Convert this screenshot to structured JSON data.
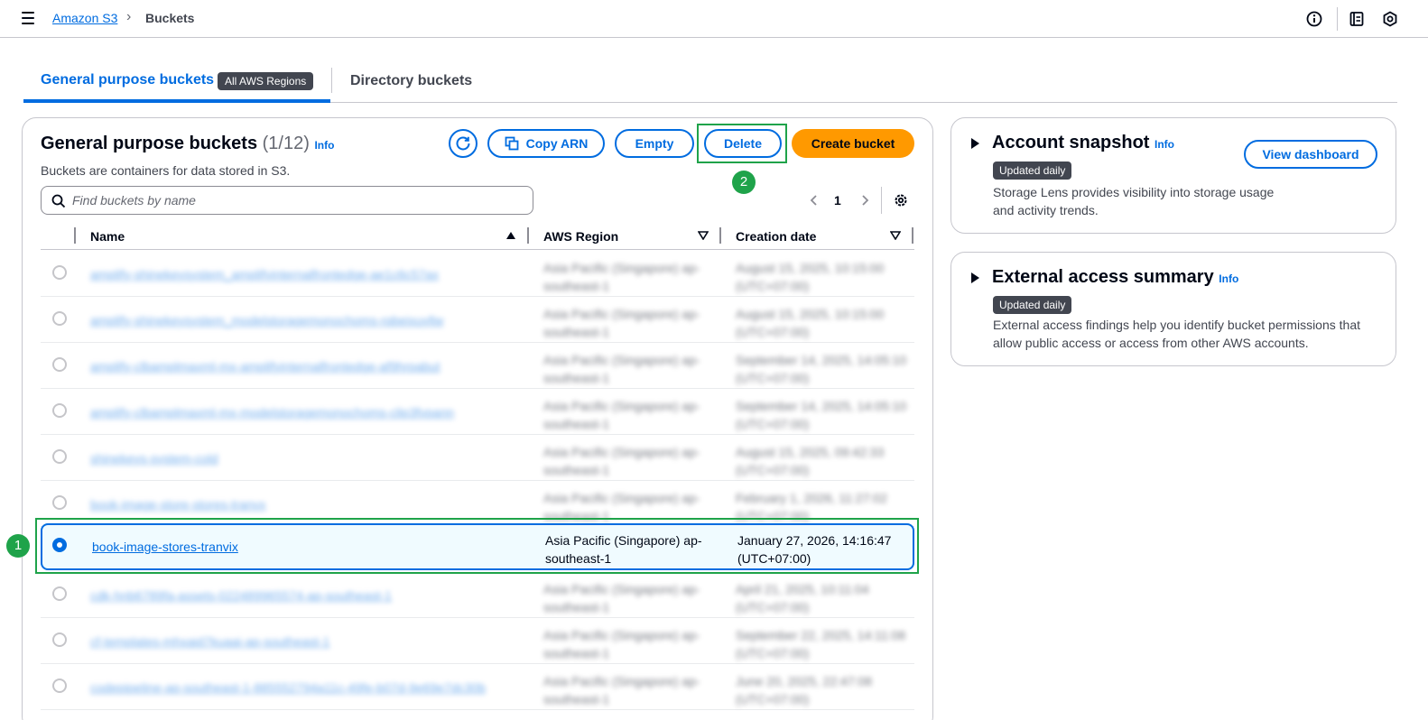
{
  "topbar": {
    "breadcrumb_root": "Amazon S3",
    "breadcrumb_separator": "›",
    "breadcrumb_current": "Buckets"
  },
  "tabs": {
    "general_label": "General purpose buckets",
    "general_badge": "All AWS Regions",
    "directory_label": "Directory buckets"
  },
  "panel": {
    "title": "General purpose buckets",
    "count": "(1/12)",
    "info": "Info",
    "description": "Buckets are containers for data stored in S3.",
    "buttons": {
      "copy_arn": "Copy ARN",
      "empty": "Empty",
      "delete": "Delete",
      "create": "Create bucket"
    },
    "search_placeholder": "Find buckets by name",
    "page_number": "1"
  },
  "table": {
    "columns": [
      "Name",
      "AWS Region",
      "Creation date"
    ],
    "rows": [
      {
        "name": "amplify-shinekeysystem_amplifyinternalfrontedge-ae1c6c57ax",
        "region": "Asia Pacific (Singapore) ap-southeast-1",
        "date": "August 15, 2025, 10:15:00 (UTC+07:00)"
      },
      {
        "name": "amplify-shinekeysystem_modelstoragemonochoms-rqbeixuyllw",
        "region": "Asia Pacific (Singapore) ap-southeast-1",
        "date": "August 15, 2025, 10:15:00 (UTC+07:00)"
      },
      {
        "name": "amplify-clbamplmaxml-mx-amplifyinternalfrontedge-af9hrpabut",
        "region": "Asia Pacific (Singapore) ap-southeast-1",
        "date": "September 14, 2025, 14:05:10 (UTC+07:00)"
      },
      {
        "name": "amplify-clbamplmaxml-mx-modelstoragemonochoms-clip3fvpann",
        "region": "Asia Pacific (Singapore) ap-southeast-1",
        "date": "September 14, 2025, 14:05:10 (UTC+07:00)"
      },
      {
        "name": "shinekeys-system-cold",
        "region": "Asia Pacific (Singapore) ap-southeast-1",
        "date": "August 15, 2025, 09:42:33 (UTC+07:00)"
      },
      {
        "name": "book-image-store-stores-tranvx",
        "region": "Asia Pacific (Singapore) ap-southeast-1",
        "date": "February 1, 2026, 11:27:02 (UTC+07:00)"
      },
      {
        "name": "book-image-stores-tranvix",
        "region": "Asia Pacific (Singapore) ap-southeast-1",
        "date": "January 27, 2026, 14:16:47 (UTC+07:00)"
      },
      {
        "name": "cdk-hnb6789fa-assets-022489965574-ap-southeast-1",
        "region": "Asia Pacific (Singapore) ap-southeast-1",
        "date": "April 21, 2025, 10:11:04 (UTC+07:00)"
      },
      {
        "name": "cf-templates-mhxaid7kuaai-ap-southeast-1",
        "region": "Asia Pacific (Singapore) ap-southeast-1",
        "date": "September 22, 2025, 14:11:08 (UTC+07:00)"
      },
      {
        "name": "codepipeline-ap-southeast-1-885552794a11c-49fe-b07d-9e69e7dc30b",
        "region": "Asia Pacific (Singapore) ap-southeast-1",
        "date": "June 20, 2025, 22:47:08 (UTC+07:00)"
      }
    ]
  },
  "cards": {
    "snapshot": {
      "title": "Account snapshot",
      "info": "Info",
      "badge": "Updated daily",
      "description": "Storage Lens provides visibility into storage usage and activity trends.",
      "button": "View dashboard"
    },
    "external": {
      "title": "External access summary",
      "info": "Info",
      "badge": "Updated daily",
      "description": "External access findings help you identify bucket permissions that allow public access or access from other AWS accounts."
    }
  },
  "annotations": {
    "step1": "1",
    "step2": "2"
  },
  "colors": {
    "link": "#006ce0",
    "primary_button": "#ff9900",
    "badge_bg": "#424650",
    "highlight": "#1fa34a"
  },
  "icons": [
    "menu-icon",
    "info-circle-icon",
    "notebook-icon",
    "settings-hex-icon",
    "refresh-icon",
    "copy-icon",
    "search-icon",
    "chevron-left-icon",
    "chevron-right-icon",
    "gear-icon",
    "sort-asc-icon",
    "sort-desc-icon",
    "expand-triangle-icon"
  ]
}
